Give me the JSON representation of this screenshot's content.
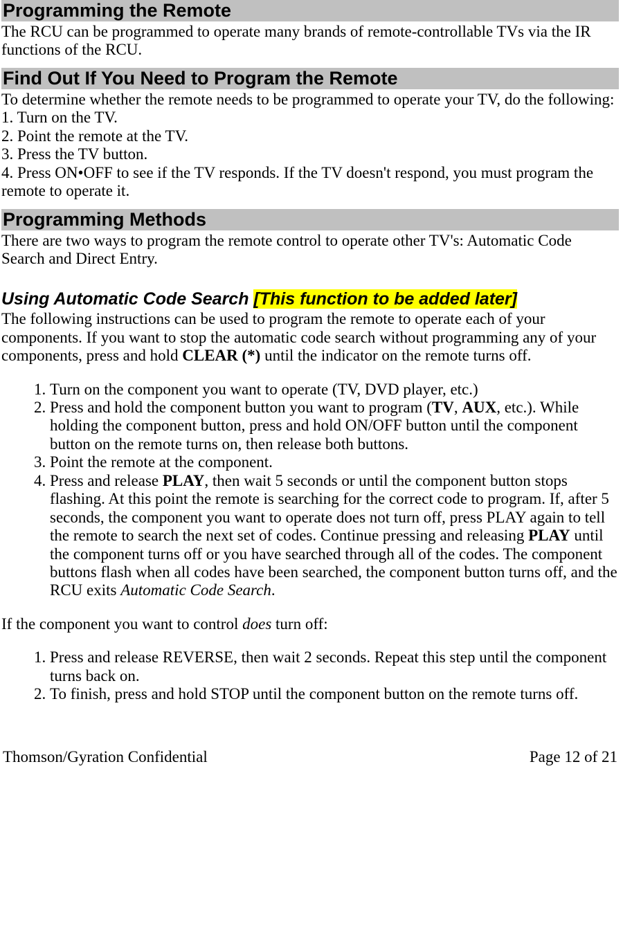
{
  "h1_1": "Programming the Remote",
  "p1": "The RCU can be programmed to operate many brands of remote-controllable TVs via the IR functions of the RCU.",
  "h1_2": "Find Out If You Need to Program the Remote",
  "p2": "To determine whether the remote needs to be programmed to operate your TV, do the following:",
  "p2_1": "1. Turn on the TV.",
  "p2_2": "2. Point the remote at the TV.",
  "p2_3": "3. Press the TV button.",
  "p2_4": "4. Press ON•OFF to see if the TV responds. If the TV doesn't respond, you must program the remote to operate it.",
  "h1_3": "Programming Methods",
  "p3": "There are two ways to program the remote control to operate other TV's: Automatic Code Search and Direct Entry.",
  "h2_1a": "Using Automatic Code Search ",
  "h2_1b": "[This function to be added later]",
  "p4_a": "The following instructions can be used to program the remote to operate each of your components. If you want to stop the automatic code search without programming any of your components, press and hold ",
  "p4_b": "CLEAR (*)",
  "p4_c": " until the indicator on the remote turns off.",
  "ol1": {
    "i1": "Turn on the component you want to operate (TV, DVD player, etc.)",
    "i2_a": "Press and hold the component button you want to program (",
    "i2_b": "TV",
    "i2_c": ", ",
    "i2_d": "AUX",
    "i2_e": ", etc.). While holding the component button, press and hold ON/OFF button until the component button on the remote turns on, then release both buttons.",
    "i3": "Point the remote at the component.",
    "i4_a": "Press and release ",
    "i4_b": "PLAY",
    "i4_c": ", then wait 5 seconds or until the component button stops flashing.  At this point the remote is searching for the correct code to program. If, after 5 seconds, the component you want to operate does not turn off, press PLAY again to tell the remote to search the next set of codes.  Continue pressing and releasing ",
    "i4_d": "PLAY",
    "i4_e": " until the component turns off or you have searched through all of the codes. The component buttons flash when all codes have been searched, the component button turns off, and the RCU exits ",
    "i4_f": "Automatic Code Search",
    "i4_g": "."
  },
  "p5_a": "If the component you want to control ",
  "p5_b": "does",
  "p5_c": " turn off:",
  "ol2": {
    "i1": "Press and release REVERSE, then wait 2 seconds. Repeat this step until the component turns back on.",
    "i2": "To finish, press and hold STOP until the component button on the remote turns off."
  },
  "footer": {
    "left": "Thomson/Gyration Confidential",
    "right": "Page 12 of 21"
  }
}
